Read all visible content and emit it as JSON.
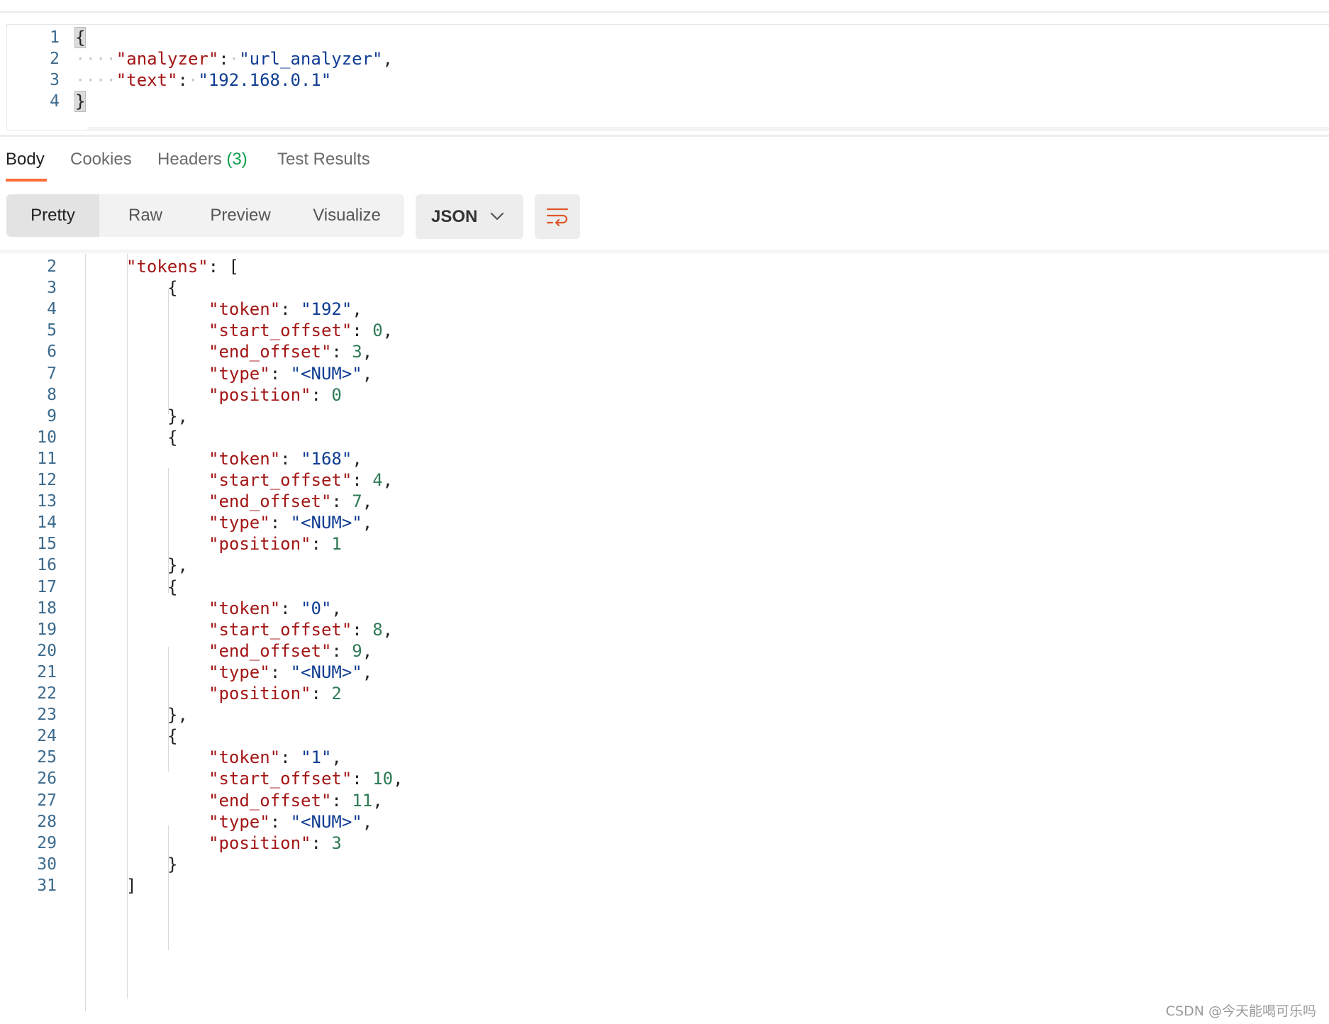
{
  "request": {
    "lines": [
      {
        "num": "1",
        "parts": [
          {
            "t": "{",
            "c": "p",
            "cursor": true
          }
        ]
      },
      {
        "num": "2",
        "parts": [
          {
            "t": "····",
            "c": "ws"
          },
          {
            "t": "\"analyzer\"",
            "c": "k"
          },
          {
            "t": ":",
            "c": "p"
          },
          {
            "t": "·",
            "c": "ws"
          },
          {
            "t": "\"url_analyzer\"",
            "c": "s"
          },
          {
            "t": ",",
            "c": "p"
          }
        ]
      },
      {
        "num": "3",
        "parts": [
          {
            "t": "····",
            "c": "ws"
          },
          {
            "t": "\"text\"",
            "c": "k"
          },
          {
            "t": ":",
            "c": "p"
          },
          {
            "t": "·",
            "c": "ws"
          },
          {
            "t": "\"192.168.0.1\"",
            "c": "s"
          }
        ]
      },
      {
        "num": "4",
        "parts": [
          {
            "t": "}",
            "c": "p",
            "cursor": true
          }
        ]
      }
    ]
  },
  "tabs": [
    {
      "label": "Body",
      "active": true
    },
    {
      "label": "Cookies"
    },
    {
      "label": "Headers",
      "count": "(3)"
    },
    {
      "label": "Test Results"
    }
  ],
  "view_modes": [
    "Pretty",
    "Raw",
    "Preview",
    "Visualize"
  ],
  "active_view": "Pretty",
  "format": "JSON",
  "icons": {
    "format_dropdown": "chevron-down-icon",
    "wrap": "wrap-lines-icon"
  },
  "colors": {
    "accent": "#ff6c37",
    "key": "#a31515",
    "string": "#0f3c92",
    "number": "#2f7a55",
    "count": "#0d9e4b",
    "line_number": "#3b6a8e"
  },
  "response": {
    "lines": [
      {
        "num": "2",
        "indent": 1,
        "parts": [
          {
            "t": "\"tokens\"",
            "c": "k"
          },
          {
            "t": ": [",
            "c": "p"
          }
        ]
      },
      {
        "num": "3",
        "indent": 2,
        "parts": [
          {
            "t": "{",
            "c": "p"
          }
        ]
      },
      {
        "num": "4",
        "indent": 3,
        "parts": [
          {
            "t": "\"token\"",
            "c": "k"
          },
          {
            "t": ": ",
            "c": "p"
          },
          {
            "t": "\"192\"",
            "c": "s"
          },
          {
            "t": ",",
            "c": "p"
          }
        ]
      },
      {
        "num": "5",
        "indent": 3,
        "parts": [
          {
            "t": "\"start_offset\"",
            "c": "k"
          },
          {
            "t": ": ",
            "c": "p"
          },
          {
            "t": "0",
            "c": "n"
          },
          {
            "t": ",",
            "c": "p"
          }
        ]
      },
      {
        "num": "6",
        "indent": 3,
        "parts": [
          {
            "t": "\"end_offset\"",
            "c": "k"
          },
          {
            "t": ": ",
            "c": "p"
          },
          {
            "t": "3",
            "c": "n"
          },
          {
            "t": ",",
            "c": "p"
          }
        ]
      },
      {
        "num": "7",
        "indent": 3,
        "parts": [
          {
            "t": "\"type\"",
            "c": "k"
          },
          {
            "t": ": ",
            "c": "p"
          },
          {
            "t": "\"<NUM>\"",
            "c": "s"
          },
          {
            "t": ",",
            "c": "p"
          }
        ]
      },
      {
        "num": "8",
        "indent": 3,
        "parts": [
          {
            "t": "\"position\"",
            "c": "k"
          },
          {
            "t": ": ",
            "c": "p"
          },
          {
            "t": "0",
            "c": "n"
          }
        ]
      },
      {
        "num": "9",
        "indent": 2,
        "parts": [
          {
            "t": "},",
            "c": "p"
          }
        ]
      },
      {
        "num": "10",
        "indent": 2,
        "parts": [
          {
            "t": "{",
            "c": "p"
          }
        ]
      },
      {
        "num": "11",
        "indent": 3,
        "parts": [
          {
            "t": "\"token\"",
            "c": "k"
          },
          {
            "t": ": ",
            "c": "p"
          },
          {
            "t": "\"168\"",
            "c": "s"
          },
          {
            "t": ",",
            "c": "p"
          }
        ]
      },
      {
        "num": "12",
        "indent": 3,
        "parts": [
          {
            "t": "\"start_offset\"",
            "c": "k"
          },
          {
            "t": ": ",
            "c": "p"
          },
          {
            "t": "4",
            "c": "n"
          },
          {
            "t": ",",
            "c": "p"
          }
        ]
      },
      {
        "num": "13",
        "indent": 3,
        "parts": [
          {
            "t": "\"end_offset\"",
            "c": "k"
          },
          {
            "t": ": ",
            "c": "p"
          },
          {
            "t": "7",
            "c": "n"
          },
          {
            "t": ",",
            "c": "p"
          }
        ]
      },
      {
        "num": "14",
        "indent": 3,
        "parts": [
          {
            "t": "\"type\"",
            "c": "k"
          },
          {
            "t": ": ",
            "c": "p"
          },
          {
            "t": "\"<NUM>\"",
            "c": "s"
          },
          {
            "t": ",",
            "c": "p"
          }
        ]
      },
      {
        "num": "15",
        "indent": 3,
        "parts": [
          {
            "t": "\"position\"",
            "c": "k"
          },
          {
            "t": ": ",
            "c": "p"
          },
          {
            "t": "1",
            "c": "n"
          }
        ]
      },
      {
        "num": "16",
        "indent": 2,
        "parts": [
          {
            "t": "},",
            "c": "p"
          }
        ]
      },
      {
        "num": "17",
        "indent": 2,
        "parts": [
          {
            "t": "{",
            "c": "p"
          }
        ]
      },
      {
        "num": "18",
        "indent": 3,
        "parts": [
          {
            "t": "\"token\"",
            "c": "k"
          },
          {
            "t": ": ",
            "c": "p"
          },
          {
            "t": "\"0\"",
            "c": "s"
          },
          {
            "t": ",",
            "c": "p"
          }
        ]
      },
      {
        "num": "19",
        "indent": 3,
        "parts": [
          {
            "t": "\"start_offset\"",
            "c": "k"
          },
          {
            "t": ": ",
            "c": "p"
          },
          {
            "t": "8",
            "c": "n"
          },
          {
            "t": ",",
            "c": "p"
          }
        ]
      },
      {
        "num": "20",
        "indent": 3,
        "parts": [
          {
            "t": "\"end_offset\"",
            "c": "k"
          },
          {
            "t": ": ",
            "c": "p"
          },
          {
            "t": "9",
            "c": "n"
          },
          {
            "t": ",",
            "c": "p"
          }
        ]
      },
      {
        "num": "21",
        "indent": 3,
        "parts": [
          {
            "t": "\"type\"",
            "c": "k"
          },
          {
            "t": ": ",
            "c": "p"
          },
          {
            "t": "\"<NUM>\"",
            "c": "s"
          },
          {
            "t": ",",
            "c": "p"
          }
        ]
      },
      {
        "num": "22",
        "indent": 3,
        "parts": [
          {
            "t": "\"position\"",
            "c": "k"
          },
          {
            "t": ": ",
            "c": "p"
          },
          {
            "t": "2",
            "c": "n"
          }
        ]
      },
      {
        "num": "23",
        "indent": 2,
        "parts": [
          {
            "t": "},",
            "c": "p"
          }
        ]
      },
      {
        "num": "24",
        "indent": 2,
        "parts": [
          {
            "t": "{",
            "c": "p"
          }
        ]
      },
      {
        "num": "25",
        "indent": 3,
        "parts": [
          {
            "t": "\"token\"",
            "c": "k"
          },
          {
            "t": ": ",
            "c": "p"
          },
          {
            "t": "\"1\"",
            "c": "s"
          },
          {
            "t": ",",
            "c": "p"
          }
        ]
      },
      {
        "num": "26",
        "indent": 3,
        "parts": [
          {
            "t": "\"start_offset\"",
            "c": "k"
          },
          {
            "t": ": ",
            "c": "p"
          },
          {
            "t": "10",
            "c": "n"
          },
          {
            "t": ",",
            "c": "p"
          }
        ]
      },
      {
        "num": "27",
        "indent": 3,
        "parts": [
          {
            "t": "\"end_offset\"",
            "c": "k"
          },
          {
            "t": ": ",
            "c": "p"
          },
          {
            "t": "11",
            "c": "n"
          },
          {
            "t": ",",
            "c": "p"
          }
        ]
      },
      {
        "num": "28",
        "indent": 3,
        "parts": [
          {
            "t": "\"type\"",
            "c": "k"
          },
          {
            "t": ": ",
            "c": "p"
          },
          {
            "t": "\"<NUM>\"",
            "c": "s"
          },
          {
            "t": ",",
            "c": "p"
          }
        ]
      },
      {
        "num": "29",
        "indent": 3,
        "parts": [
          {
            "t": "\"position\"",
            "c": "k"
          },
          {
            "t": ": ",
            "c": "p"
          },
          {
            "t": "3",
            "c": "n"
          }
        ]
      },
      {
        "num": "30",
        "indent": 2,
        "parts": [
          {
            "t": "}",
            "c": "p"
          }
        ]
      },
      {
        "num": "31",
        "indent": 1,
        "parts": [
          {
            "t": "]",
            "c": "p"
          }
        ]
      }
    ]
  },
  "watermark": "CSDN @今天能喝可乐吗"
}
